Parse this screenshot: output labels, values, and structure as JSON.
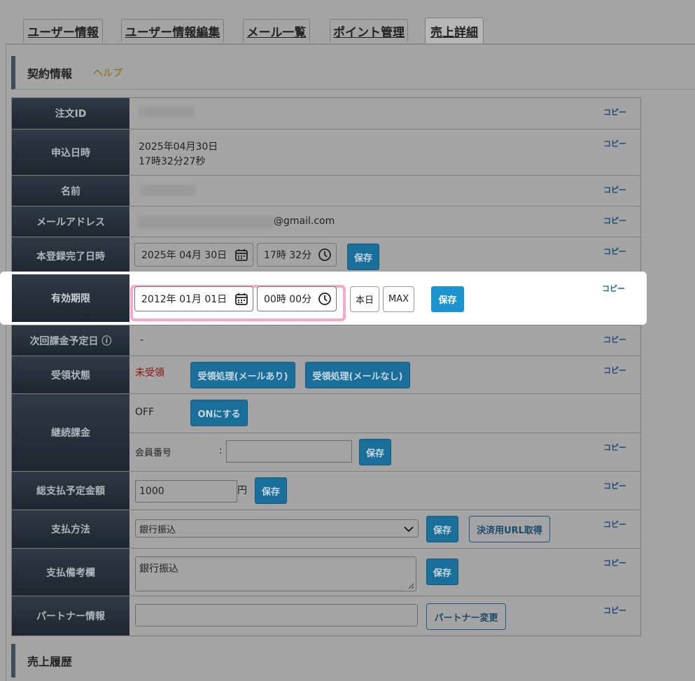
{
  "tabs": [
    {
      "label": "ユーザー情報"
    },
    {
      "label": "ユーザー情報編集"
    },
    {
      "label": "メール一覧"
    },
    {
      "label": "ポイント管理"
    },
    {
      "label": "売上詳細"
    }
  ],
  "contract": {
    "title": "契約情報",
    "help": "ヘルプ"
  },
  "copy_label": "コピー",
  "rows": {
    "order_id": {
      "label": "注文ID"
    },
    "applied": {
      "label": "申込日時",
      "date": "2025年04月30日",
      "time": "17時32分27秒"
    },
    "name": {
      "label": "名前"
    },
    "email": {
      "label": "メールアドレス",
      "suffix": "@gmail.com"
    },
    "registered": {
      "label": "本登録完了日時",
      "date": "2025年 04月 30日",
      "time": "17時 32分",
      "save": "保存"
    },
    "expiry": {
      "label": "有効期限",
      "date": "2012年 01月 01日",
      "time": "00時 00分",
      "today": "本日",
      "max": "MAX",
      "save": "保存"
    },
    "next_billing": {
      "label": "次回課金予定日 ⓘ",
      "value": "-"
    },
    "receipt": {
      "label": "受領状態",
      "status": "未受領",
      "btn_with_mail": "受領処理(メールあり)",
      "btn_without_mail": "受領処理(メールなし)"
    },
    "continuous": {
      "label": "継続課金",
      "status": "OFF",
      "on_btn": "ONにする",
      "member_label": "会員番号",
      "colon": ":",
      "member_value": "",
      "save": "保存"
    },
    "total": {
      "label": "総支払予定金額",
      "value": "1000",
      "unit": "円",
      "save": "保存"
    },
    "method": {
      "label": "支払方法",
      "selected": "銀行振込",
      "save": "保存",
      "url_btn": "決済用URL取得"
    },
    "note": {
      "label": "支払備考欄",
      "value": "銀行振込",
      "save": "保存"
    },
    "partner": {
      "label": "パートナー情報",
      "value": "",
      "change_btn": "パートナー変更"
    }
  },
  "sales_history": {
    "title": "売上履歴"
  }
}
